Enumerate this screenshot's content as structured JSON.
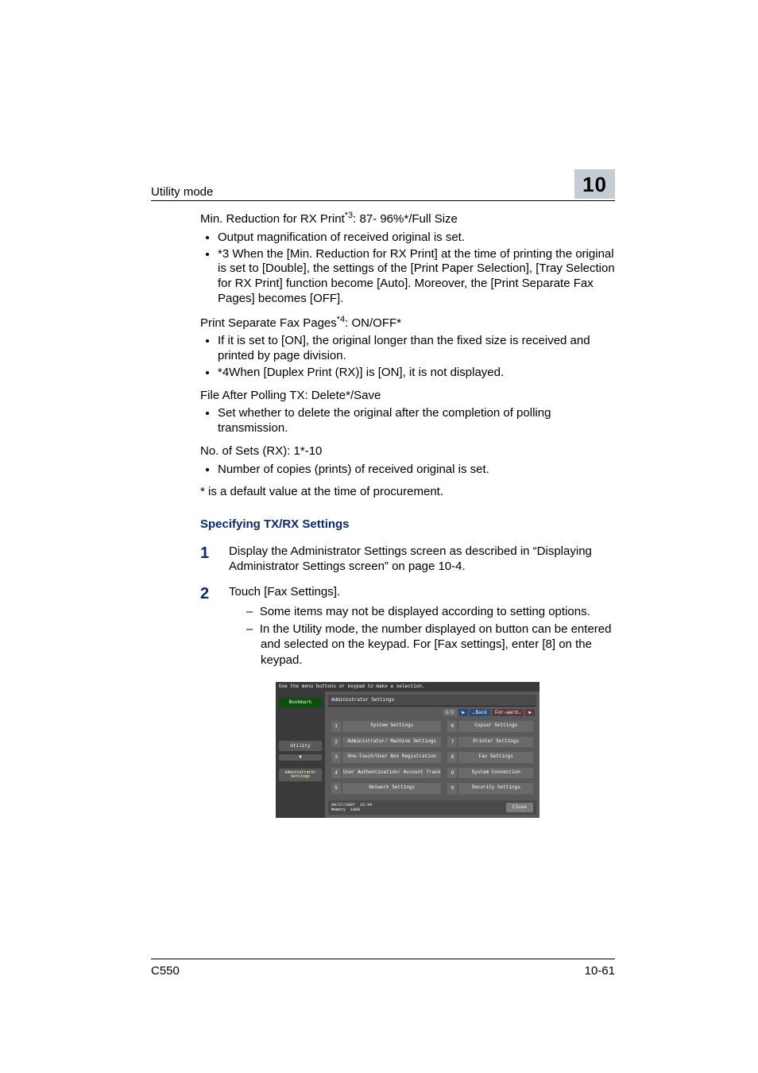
{
  "header": {
    "title": "Utility mode",
    "chapter": "10"
  },
  "body": {
    "minReduction": {
      "label": "Min. Reduction for RX Print",
      "sup": "*3",
      "values": ": 87- 96%*/Full Size"
    },
    "minReductionBullets": [
      "Output magnification of received original is set.",
      "*3 When the [Min. Reduction for RX Print] at the time of printing the original is set to [Double], the settings of the [Print Paper Selection], [Tray Selection for RX Print] function become [Auto]. Moreover, the [Print Separate Fax Pages] becomes [OFF]."
    ],
    "printSeparate": {
      "label": "Print Separate Fax Pages",
      "sup": "*4",
      "values": ": ON/OFF*"
    },
    "printSeparateBullets": [
      "If it is set to [ON], the original longer than the fixed size is received and printed by page division.",
      "*4When [Duplex Print (RX)] is [ON], it is not displayed."
    ],
    "fileAfter": {
      "line": "File After Polling TX: Delete*/Save"
    },
    "fileAfterBullets": [
      "Set whether to delete the original after the completion of polling transmission."
    ],
    "noSets": {
      "line": "No. of Sets (RX): 1*-10"
    },
    "noSetsBullets": [
      "Number of copies (prints) of received original is set."
    ],
    "defaultNote": "* is a default value at the time of procurement.",
    "sectionTitle": "Specifying TX/RX Settings",
    "step1": {
      "num": "1",
      "text": "Display the Administrator Settings screen as described in “Displaying Administrator Settings screen” on page 10-4."
    },
    "step2": {
      "num": "2",
      "text": "Touch [Fax Settings].",
      "dashes": [
        "Some items may not be displayed according to setting options.",
        "In the Utility mode, the number displayed on button can be entered and selected on the keypad. For [Fax settings], enter [8] on the keypad."
      ]
    }
  },
  "device": {
    "topText": "Use the menu buttons or keypad to make a selection.",
    "left": {
      "bookmark": "Bookmark",
      "utility": "Utility",
      "admin": "Administrator Settings"
    },
    "title": "Administrator Settings",
    "nav": {
      "page": "1/2",
      "back": "←Back",
      "fwd": "For-ward→"
    },
    "buttons": [
      {
        "n": "1",
        "label": "System Settings"
      },
      {
        "n": "6",
        "label": "Copier Settings"
      },
      {
        "n": "2",
        "label": "Administrator/ Machine Settings"
      },
      {
        "n": "7",
        "label": "Printer Settings"
      },
      {
        "n": "3",
        "label": "One-Touch/User Box Registration"
      },
      {
        "n": "8",
        "label": "Fax Settings"
      },
      {
        "n": "4",
        "label": "User Authentication/ Account Track"
      },
      {
        "n": "9",
        "label": "System Connection"
      },
      {
        "n": "5",
        "label": "Network Settings"
      },
      {
        "n": "0",
        "label": "Security Settings"
      }
    ],
    "bottom": {
      "date": "09/27/2007",
      "time": "15:44",
      "memLabel": "Memory",
      "mem": "100%",
      "close": "Close"
    }
  },
  "footer": {
    "left": "C550",
    "right": "10-61"
  }
}
